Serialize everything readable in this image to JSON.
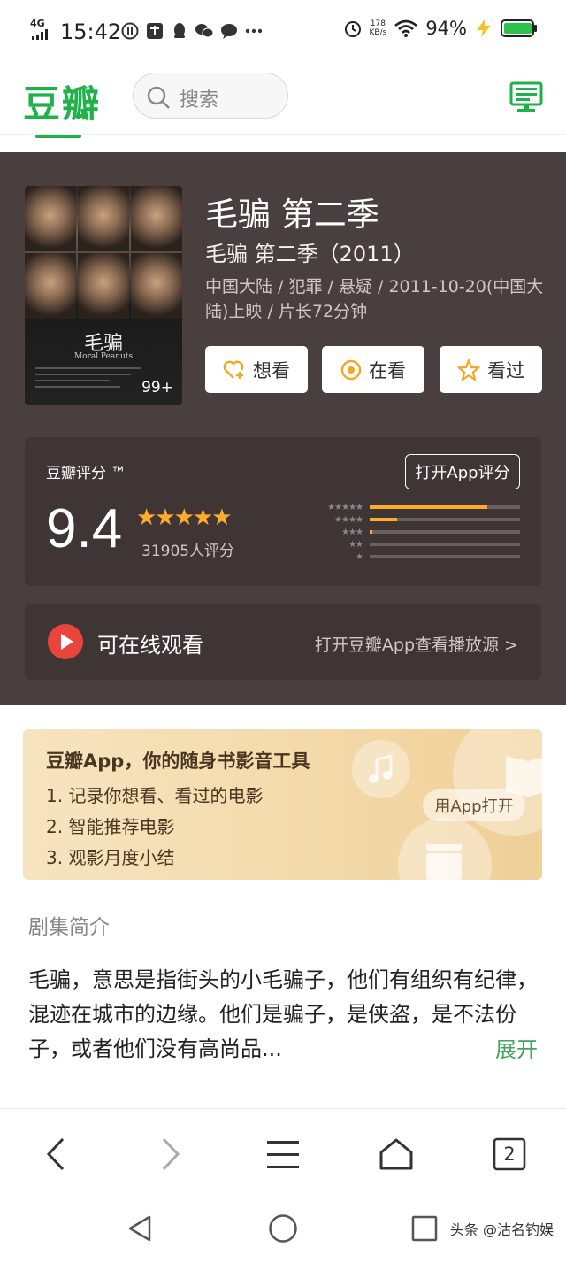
{
  "status_bar": {
    "network": "4G",
    "time": "15:42",
    "net_speed_value": "178",
    "net_speed_unit": "KB/s",
    "battery": "94%"
  },
  "header": {
    "logo": "豆瓣",
    "search_placeholder": "搜索"
  },
  "movie": {
    "title": "毛骗 第二季",
    "subtitle": "毛骗 第二季（2011）",
    "info": "中国大陆 / 犯罪 / 悬疑 / 2011-10-20(中国大陆)上映 / 片长72分钟",
    "poster_title": "毛骗",
    "poster_subtitle": "Moral Peanuts",
    "poster_count": "99+"
  },
  "actions": {
    "want": "想看",
    "watching": "在看",
    "watched": "看过"
  },
  "rating": {
    "label": "豆瓣评分 ™",
    "open_app": "打开App评分",
    "score": "9.4",
    "stars": "★★★★★",
    "count": "31905人评分",
    "distribution": [
      0.78,
      0.18,
      0.02,
      0.0,
      0.0
    ]
  },
  "watch": {
    "label": "可在线观看",
    "link": "打开豆瓣App查看播放源 >"
  },
  "promo": {
    "title": "豆瓣App，你的随身书影音工具",
    "items": [
      "1.  记录你想看、看过的电影",
      "2.  智能推荐电影",
      "3.  观影月度小结"
    ],
    "button": "用App打开"
  },
  "intro": {
    "heading": "剧集简介",
    "text": "毛骗，意思是指街头的小毛骗子，他们有组织有纪律，混迹在城市的边缘。他们是骗子，是侠盗，是不法份子，或者他们没有高尚品...",
    "more": "展开"
  },
  "browser": {
    "tab_count": "2"
  },
  "watermark": "头条 @沽名钓娱",
  "colors": {
    "brand_green": "#1fb24a",
    "star_orange": "#ffac2d",
    "panel_dark": "#4a3f3f",
    "play_red": "#e9453d"
  }
}
